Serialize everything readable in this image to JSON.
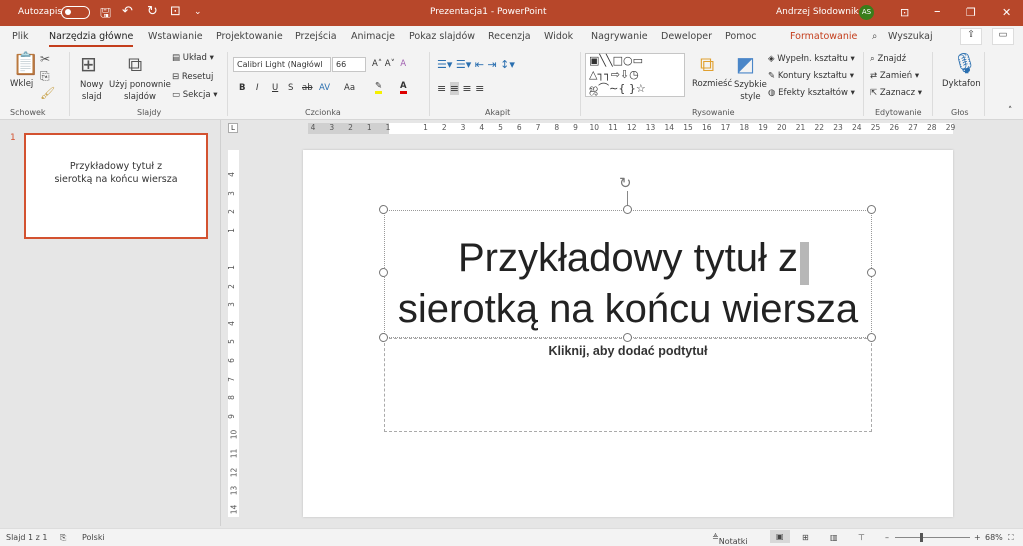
{
  "titlebar": {
    "autosave": "Autozapis",
    "doc_title": "Prezentacja1  -  PowerPoint",
    "user": "Andrzej Słodownik",
    "avatar": "AS",
    "colors": {
      "bar": "#b7472a",
      "avatar": "#3a7d1a"
    }
  },
  "tabs": [
    "Plik",
    "Narzędzia główne",
    "Wstawianie",
    "Projektowanie",
    "Przejścia",
    "Animacje",
    "Pokaz slajdów",
    "Recenzja",
    "Widok",
    "Nagrywanie",
    "Deweloper",
    "Pomoc",
    "Formatowanie"
  ],
  "search": "Wyszukaj",
  "ribbon": {
    "clipboard": {
      "paste": "Wklej",
      "group": "Schowek"
    },
    "slides": {
      "new_slide": "Nowy\nslajd",
      "reuse": "Użyj ponownie\nslajdów",
      "layout": "Układ",
      "reset": "Resetuj",
      "section": "Sekcja",
      "group": "Slajdy"
    },
    "font": {
      "name": "Calibri Light (Nagłówl",
      "size": "66",
      "bold": "B",
      "italic": "I",
      "underline": "U",
      "shadow": "S",
      "strike": "ab",
      "spacing": "AV",
      "case": "Aa",
      "group": "Czcionka"
    },
    "paragraph": {
      "group": "Akapit"
    },
    "drawing": {
      "arrange": "Rozmieść",
      "quick_styles": "Szybkie\nstyle",
      "fill": "Wypełn. kształtu",
      "outline": "Kontury kształtu",
      "effects": "Efekty kształtów",
      "group": "Rysowanie"
    },
    "editing": {
      "find": "Znajdź",
      "replace": "Zamień",
      "select": "Zaznacz",
      "group": "Edytowanie"
    },
    "voice": {
      "dictate": "Dyktafon",
      "group": "Głos"
    }
  },
  "thumbnail": {
    "number": "1",
    "text": "Przykładowy tytuł z\nsierotką na końcu wiersza"
  },
  "ruler": {
    "h": [
      "4",
      "3",
      "2",
      "1",
      "1",
      "",
      "1",
      "2",
      "3",
      "4",
      "5",
      "6",
      "7",
      "8",
      "9",
      "10",
      "11",
      "12",
      "13",
      "14",
      "15",
      "16",
      "17",
      "18",
      "19",
      "20",
      "21",
      "22",
      "23",
      "24",
      "25",
      "26",
      "27",
      "28",
      "29"
    ],
    "v": [
      "4",
      "3",
      "2",
      "1",
      "",
      "1",
      "2",
      "3",
      "4",
      "5",
      "6",
      "7",
      "8",
      "9",
      "10",
      "11",
      "12",
      "13",
      "14"
    ]
  },
  "slide": {
    "title": "Przykładowy tytuł z\nsierotką na końcu wiersza",
    "subtitle": "Kliknij, aby dodać podtytuł"
  },
  "status": {
    "slide": "Slajd 1 z 1",
    "language": "Polski",
    "notes": "Notatki",
    "zoom": "68%",
    "zoom_value": 68
  }
}
